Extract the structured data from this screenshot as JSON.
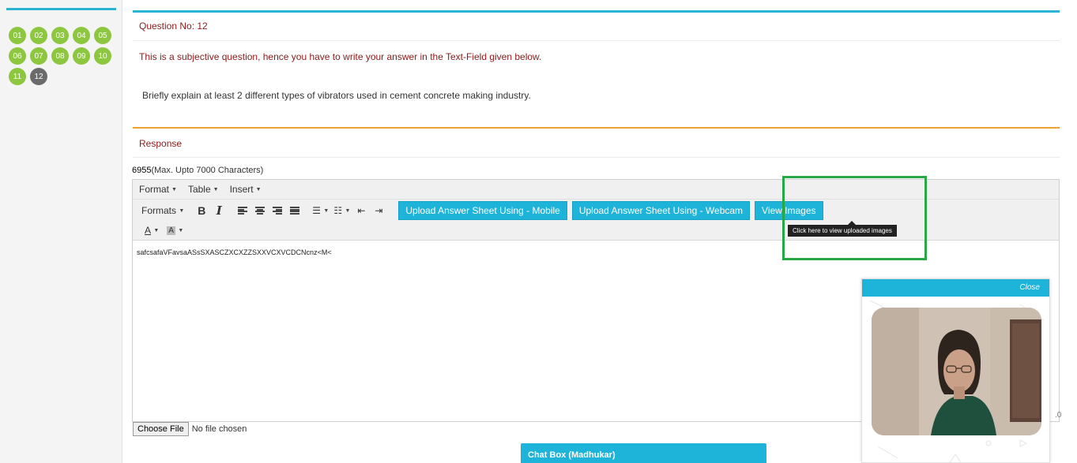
{
  "palette": {
    "questions": [
      {
        "label": "01",
        "state": "answered"
      },
      {
        "label": "02",
        "state": "answered"
      },
      {
        "label": "03",
        "state": "answered"
      },
      {
        "label": "04",
        "state": "answered"
      },
      {
        "label": "05",
        "state": "answered"
      },
      {
        "label": "06",
        "state": "answered"
      },
      {
        "label": "07",
        "state": "answered"
      },
      {
        "label": "08",
        "state": "answered"
      },
      {
        "label": "09",
        "state": "answered"
      },
      {
        "label": "10",
        "state": "answered"
      },
      {
        "label": "11",
        "state": "answered"
      },
      {
        "label": "12",
        "state": "current"
      }
    ],
    "answered_color": "#8dc63f",
    "current_color": "#6b6b6b"
  },
  "question": {
    "number_label": "Question No: 12",
    "instruction": "This is a subjective question, hence you have to write your answer in the Text-Field given below.",
    "text": "Briefly explain at least 2 different types of vibrators used in cement concrete making industry."
  },
  "response": {
    "title": "Response",
    "count": "6955",
    "limit_text": "(Max. Upto 7000 Characters)"
  },
  "editor": {
    "menus": [
      "Format",
      "Table",
      "Insert"
    ],
    "formats_label": "Formats",
    "bold_label": "B",
    "italic_label": "I",
    "upload_mobile_label": "Upload Answer Sheet Using - Mobile",
    "upload_webcam_label": "Upload Answer Sheet Using - Webcam",
    "view_images_label": "View Images",
    "tooltip": "Click here to view uploaded images",
    "text_color_label": "A",
    "bg_color_label": "A",
    "content": "safcsafaVFavsaASsSXASCZXCXZZSXXVCXVCDCNcnz<M<"
  },
  "file_input": {
    "button_label": "Choose File",
    "status": "No file chosen"
  },
  "edge_number": ".0",
  "chat": {
    "title": "Chat Box (Madhukar)"
  },
  "webcam": {
    "close_label": "Close"
  },
  "colors": {
    "accent": "#1eb3d8",
    "highlight": "#27a745",
    "question_text": "#8b1a1a"
  }
}
